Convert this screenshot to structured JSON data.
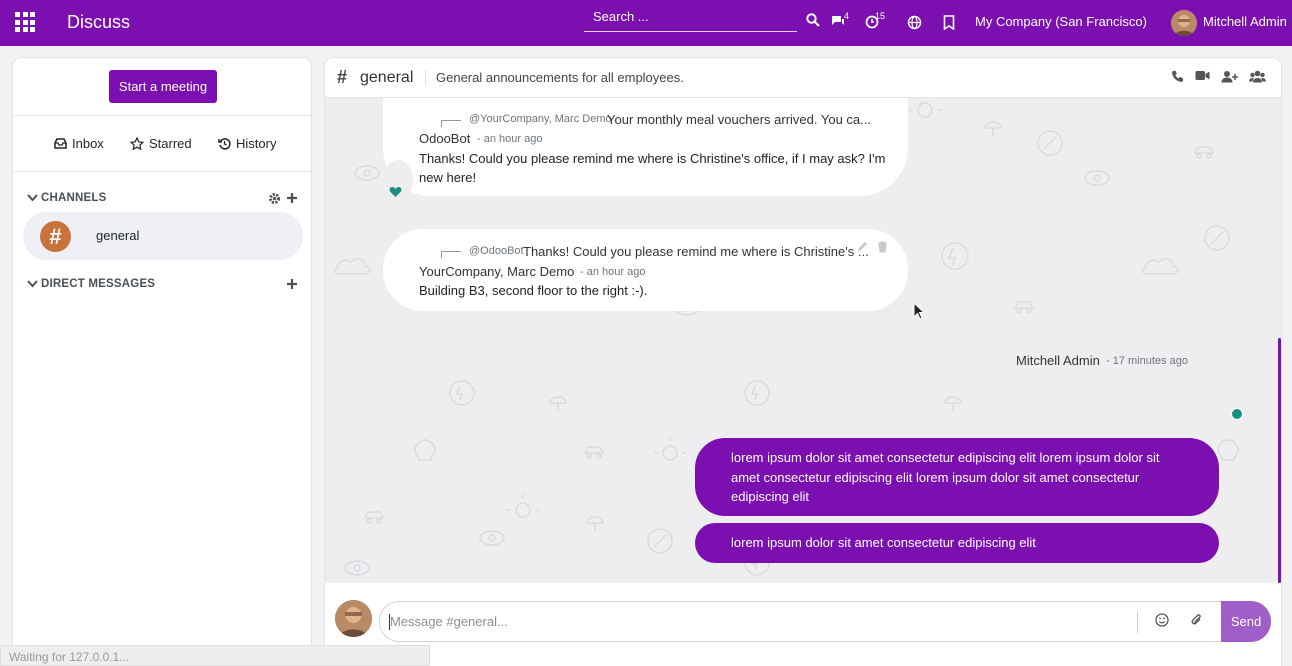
{
  "topbar": {
    "app_title": "Discuss",
    "search_placeholder": "Search ...",
    "messages_badge": "4",
    "activities_badge": "15",
    "company": "My Company (San Francisco)",
    "user_name": "Mitchell Admin",
    "icons": [
      "apps-icon",
      "search-icon",
      "chat-icon",
      "clock-icon",
      "globe-icon",
      "bookmark-icon"
    ],
    "color": "#7c0fb0"
  },
  "sidebar": {
    "start_meeting_label": "Start a meeting",
    "nav": [
      {
        "label": "Inbox",
        "icon": "inbox-icon"
      },
      {
        "label": "Starred",
        "icon": "star-icon"
      },
      {
        "label": "History",
        "icon": "history-icon"
      }
    ],
    "channels_heading": "CHANNELS",
    "channel_name": "general",
    "direct_heading": "DIRECT MESSAGES"
  },
  "thread": {
    "hash": "#",
    "name": "general",
    "description": "General announcements for all employees.",
    "tools": [
      "phone-icon",
      "video-icon",
      "add-user-icon",
      "members-icon"
    ]
  },
  "messages": [
    {
      "reply_author": "@YourCompany, Marc Demo",
      "reply_text": "Your monthly meal vouchers arrived. You ca...",
      "author": "OdooBot",
      "time": "- an hour ago",
      "body": "Thanks! Could you please remind me where is Christine's office, if I may ask? I'm new here!"
    },
    {
      "reply_author": "@OdooBot",
      "reply_text": "Thanks! Could you please remind me where is Christine's ...",
      "author": "YourCompany, Marc Demo",
      "time": "- an hour ago",
      "body": "Building B3, second floor to the right :-)."
    }
  ],
  "own_messages": {
    "author": "Mitchell Admin",
    "time": "- 17 minutes ago",
    "items": [
      "lorem ipsum dolor sit amet consectetur edipiscing elit lorem ipsum dolor sit amet consectetur edipiscing elit lorem ipsum dolor sit amet consectetur edipiscing elit",
      "lorem ipsum dolor sit amet consectetur edipiscing elit"
    ]
  },
  "composer": {
    "placeholder": "Message #general...",
    "send_label": "Send"
  },
  "status_text": "Waiting for 127.0.0.1..."
}
